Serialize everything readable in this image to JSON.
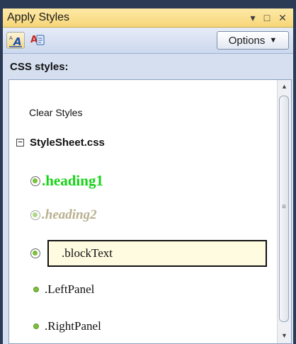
{
  "window": {
    "title": "Apply Styles",
    "dropdown_icon": "▾",
    "maximize_icon": "□",
    "close_icon": "✕"
  },
  "toolbar": {
    "options_label": "Options",
    "options_arrow": "▼"
  },
  "section": {
    "header": "CSS styles:"
  },
  "list": {
    "clear_styles": "Clear Styles",
    "stylesheet": {
      "toggle": "−",
      "name": "StyleSheet.css"
    },
    "styles": [
      {
        "name": ".heading1",
        "color": "#17d317",
        "marker": "ring"
      },
      {
        "name": ".heading2",
        "color": "#b8b08f",
        "marker": "ring"
      },
      {
        "name": ".blockText",
        "color": "#111111",
        "marker": "ring",
        "selected": true
      },
      {
        "name": ".LeftPanel",
        "color": "#111111",
        "marker": "dot"
      },
      {
        "name": ".RightPanel",
        "color": "#111111",
        "marker": "dot"
      }
    ]
  },
  "scrollbar": {
    "up_arrow": "▲",
    "down_arrow": "▼",
    "grip": "≡"
  },
  "colors": {
    "titlebar": "#f7d679",
    "panel": "#d5dff0",
    "selection_bg": "#fffbe0",
    "marker_green": "#7bbf3c"
  }
}
